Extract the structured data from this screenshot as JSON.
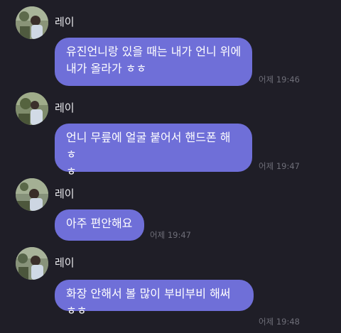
{
  "messages": [
    {
      "sender": "레이",
      "avatar_icon": "profile-photo",
      "text_lines": [
        "유진언니랑 있을 때는 내가 언니 위에",
        "내가 올라가 ㅎㅎ"
      ],
      "time": "어제 19:46"
    },
    {
      "sender": "레이",
      "avatar_icon": "profile-photo",
      "text_lines": [
        "언니 무릎에 얼굴 붙어서 핸드폰 해 ㅎ",
        "ㅎ"
      ],
      "time": "어제 19:47"
    },
    {
      "sender": "레이",
      "avatar_icon": "profile-photo",
      "text_lines": [
        "아주 편안해요"
      ],
      "time": "어제 19:47"
    },
    {
      "sender": "레이",
      "avatar_icon": "profile-photo",
      "text_lines": [
        "화장 안해서 볼 많이 부비부비 해써 ㅎㅎ"
      ],
      "time": "어제 19:48"
    }
  ],
  "colors": {
    "background": "#1f1e27",
    "bubble": "#6f6fd8",
    "sender_text": "#e8e8ec",
    "timestamp_text": "#6e6e78"
  }
}
